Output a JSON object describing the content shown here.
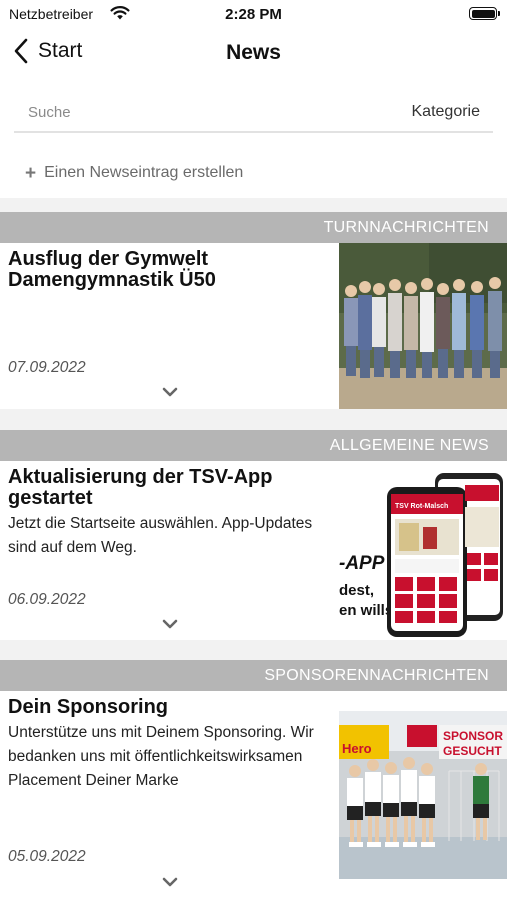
{
  "status_bar": {
    "carrier": "Netzbetreiber",
    "time": "2:28 PM"
  },
  "nav": {
    "back_label": "Start",
    "title": "News"
  },
  "search": {
    "placeholder": "Suche",
    "category_label": "Kategorie"
  },
  "create": {
    "label": "Einen Newseintrag erstellen"
  },
  "news": [
    {
      "category": "TURNNACHRICHTEN",
      "title": "Ausflug der Gymwelt Damengymnastik Ü50",
      "text": "",
      "date": "07.09.2022"
    },
    {
      "category": "ALLGEMEINE NEWS",
      "title": "Aktualisierung der TSV-App gestartet",
      "text": "Jetzt die Startseite auswählen. App-Updates sind auf dem Weg.",
      "date": "06.09.2022",
      "image_text": {
        "app_line": "-APP",
        "line2": "dest,",
        "line3": "en willst!",
        "screen_header": "TSV Rot-Malsch"
      }
    },
    {
      "category": "SPONSORENNACHRICHTEN",
      "title": "Dein Sponsoring",
      "text": "Unterstütze uns mit Deinem Sponsoring. Wir bedanken uns mit öffentlichkeitswirksamen Placement Deiner Marke",
      "date": "05.09.2022",
      "image_text": {
        "banner_left": "Hero",
        "banner_right_1": "SPONSOR",
        "banner_right_2": "GESUCHT"
      }
    }
  ]
}
